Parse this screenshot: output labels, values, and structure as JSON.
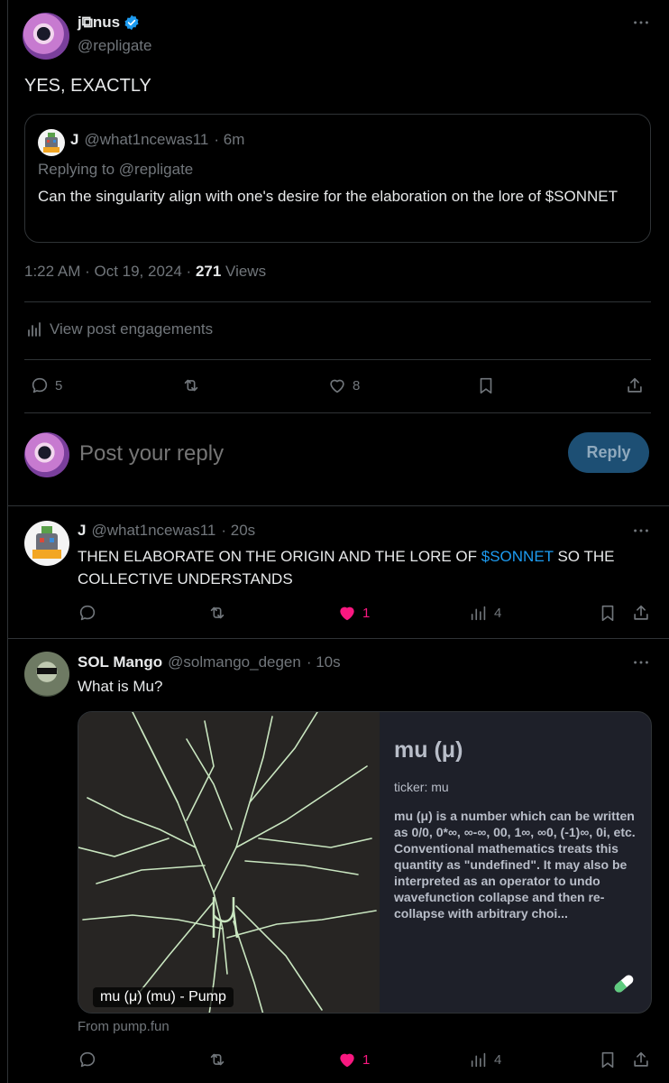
{
  "main_post": {
    "display_name": "j⧉nus",
    "handle": "@repligate",
    "text": "YES, EXACTLY",
    "timestamp": "1:22 AM · Oct 19, 2024 · ",
    "views_count": "271",
    "views_label": " Views",
    "engagements_label": "View post engagements",
    "actions": {
      "replies": "5",
      "reposts": "",
      "likes": "8"
    }
  },
  "quoted_post": {
    "display_name": "J",
    "handle": "@what1ncewas11",
    "time": "· 6m",
    "replying_to": "Replying to @repligate",
    "text": "Can the singularity align with one's desire for the elaboration on the lore of $SONNET"
  },
  "compose": {
    "placeholder": "Post your reply",
    "reply_button": "Reply"
  },
  "reply1": {
    "display_name": "J",
    "handle": "@what1ncewas11",
    "time": "· 20s",
    "text_before": "THEN ELABORATE ON THE ORIGIN AND THE LORE OF ",
    "cashtag": "$SONNET",
    "text_after": " SO THE COLLECTIVE UNDERSTANDS",
    "likes": "1",
    "views": "4"
  },
  "reply2": {
    "display_name": "SOL Mango",
    "handle": "@solmango_degen",
    "time": "· 10s",
    "text": "What is Mu?",
    "card": {
      "title": "mu (μ)",
      "ticker": "ticker: mu",
      "description": "mu (μ) is a number which can be written as 0/0, 0*∞, ∞-∞, 00, 1∞, ∞0, (-1)∞, 0i, etc. Conventional mathematics treats this quantity as \"undefined\". It may also be interpreted as an operator to undo wavefunction collapse and then re-collapse with arbitrary choi...",
      "image_label": "mu (μ) (mu) - Pump",
      "source": "From pump.fun"
    },
    "likes": "1",
    "views": "4"
  },
  "colors": {
    "accent": "#1d9bf0",
    "like_active": "#f91880",
    "verified": "#1d9bf0"
  }
}
